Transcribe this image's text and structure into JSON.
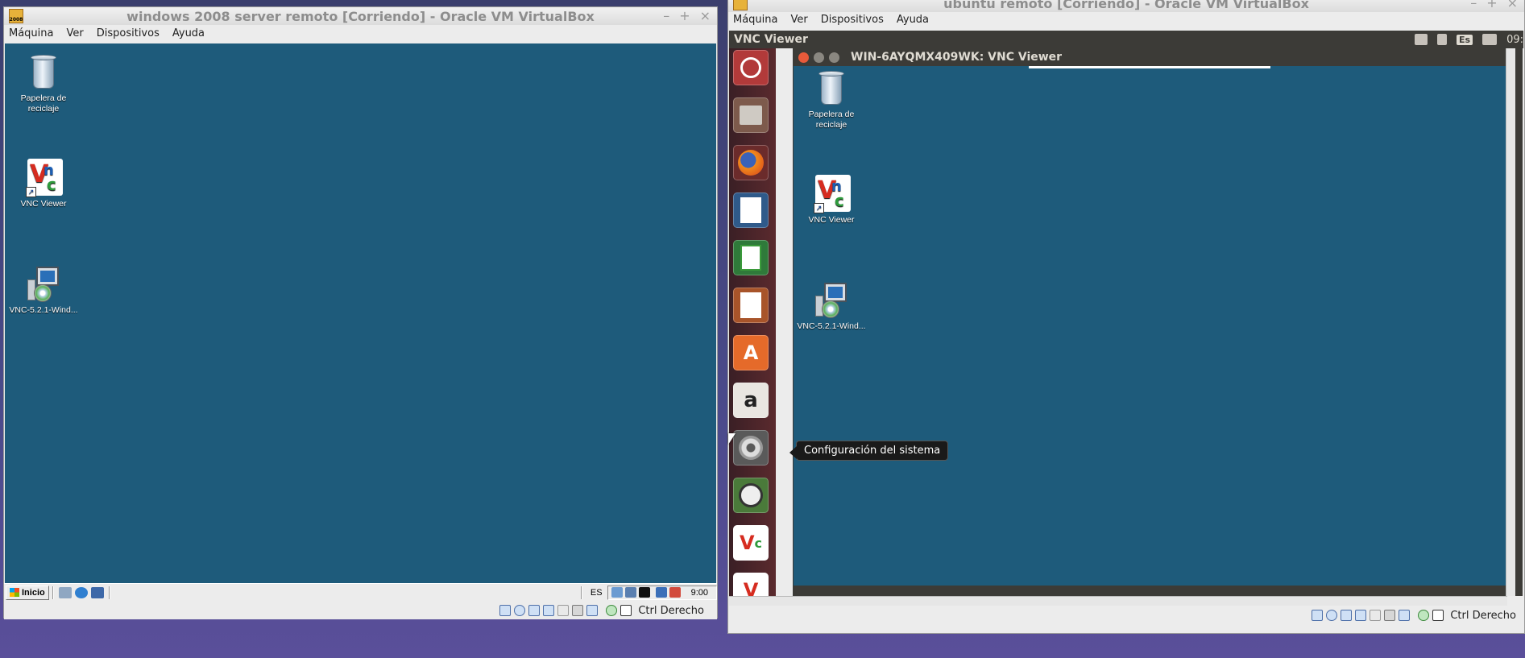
{
  "left_window": {
    "title": "windows 2008 server remoto [Corriendo] - Oracle VM VirtualBox",
    "app_icon_text": "2008",
    "menu": [
      "Máquina",
      "Ver",
      "Dispositivos",
      "Ayuda"
    ],
    "desktop_icons": [
      "Papelera de reciclaje",
      "VNC Viewer",
      "VNC-5.2.1-Wind..."
    ],
    "taskbar": {
      "start_label": "Inicio",
      "lang": "ES",
      "clock": "9:00"
    },
    "statusbar": {
      "host_key": "Ctrl Derecho"
    }
  },
  "right_window": {
    "title": "ubuntu remoto [Corriendo] - Oracle VM VirtualBox",
    "menu": [
      "Máquina",
      "Ver",
      "Dispositivos",
      "Ayuda"
    ],
    "ubuntu_panel": {
      "app_title": "VNC Viewer",
      "lang": "Es",
      "clock": "09:"
    },
    "inner_window_title": "WIN-6AYQMX409WK: VNC Viewer",
    "desktop_icons": [
      "Papelera de reciclaje",
      "VNC Viewer",
      "VNC-5.2.1-Wind..."
    ],
    "tooltip": "Configuración del sistema",
    "statusbar": {
      "host_key": "Ctrl Derecho"
    }
  },
  "launcher_icons": [
    "ubuntu-dash-icon",
    "files-icon",
    "firefox-icon",
    "writer-icon",
    "calc-icon",
    "impress-icon",
    "software-center-icon",
    "amazon-icon",
    "system-settings-icon",
    "software-updater-icon",
    "vnc-viewer-icon",
    "vnc-viewer-icon-2"
  ]
}
